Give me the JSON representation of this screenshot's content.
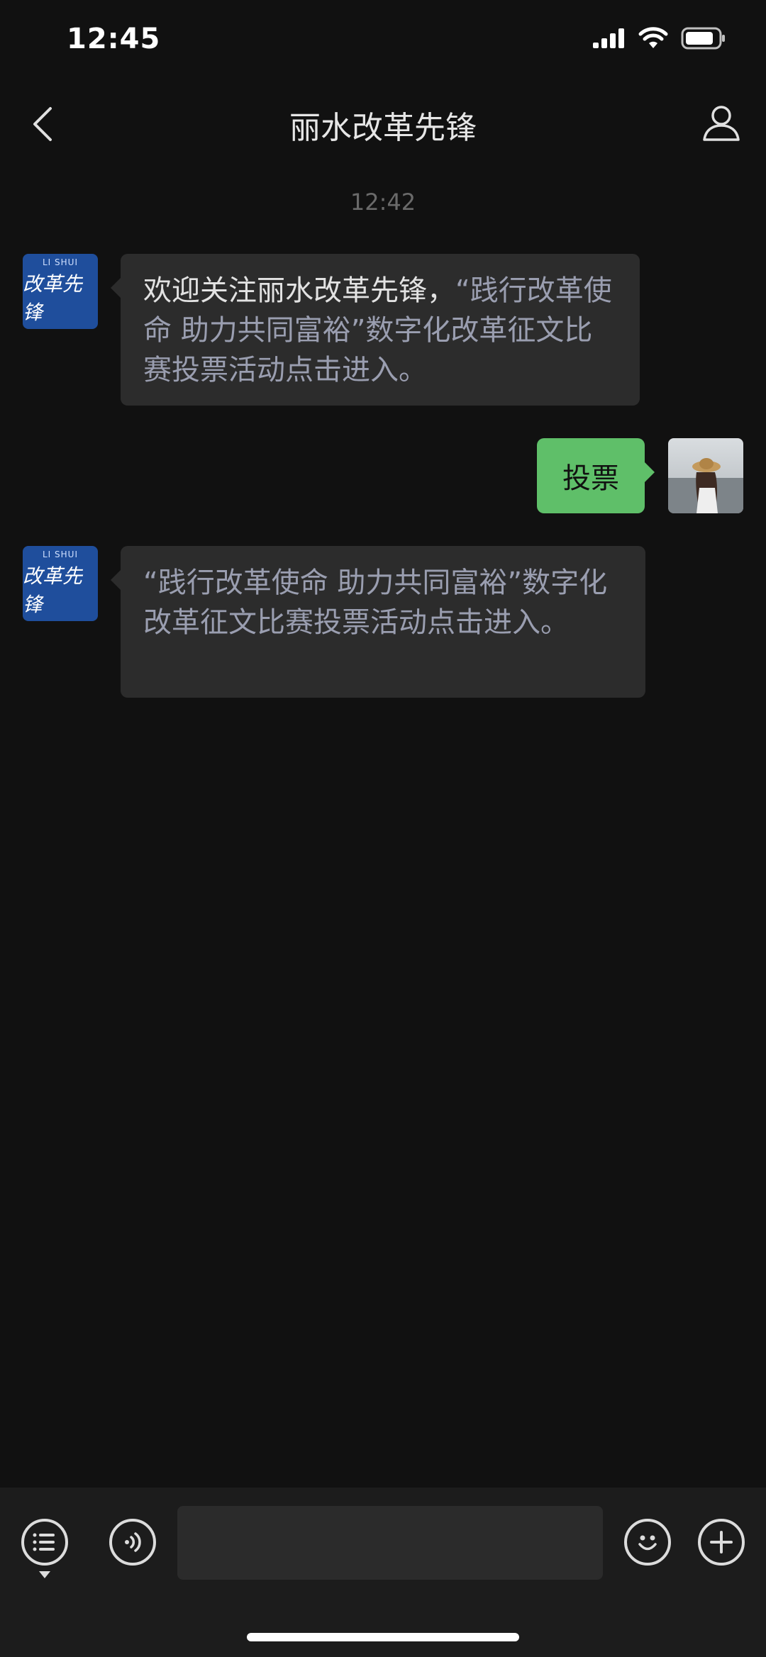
{
  "status_bar": {
    "time": "12:45"
  },
  "nav": {
    "title": "丽水改革先锋"
  },
  "chat": {
    "timestamp": "12:42",
    "messages": [
      {
        "sender": "official",
        "avatar_text": "改革先锋",
        "avatar_small": "LI SHUI",
        "plain_text": "欢迎关注丽水改革先锋，",
        "link_text": "“践行改革使命 助力共同富裕”数字化改革征文比赛投票活动点击进入。"
      },
      {
        "sender": "me",
        "text": "投票"
      },
      {
        "sender": "official",
        "avatar_text": "改革先锋",
        "avatar_small": "LI SHUI",
        "link_text": "“践行改革使命 助力共同富裕”数字化改革征文比赛投票活动点击进入。"
      }
    ]
  },
  "colors": {
    "background": "#111111",
    "bubble_incoming": "#2c2c2c",
    "bubble_outgoing": "#5fbf69",
    "link": "#9a9eb0",
    "brand_blue": "#1f4e9c"
  },
  "icons": {
    "back": "chevron-left-icon",
    "profile": "person-icon",
    "menu": "list-menu-icon",
    "voice": "voice-icon",
    "emoji": "smiley-icon",
    "more": "plus-icon"
  }
}
